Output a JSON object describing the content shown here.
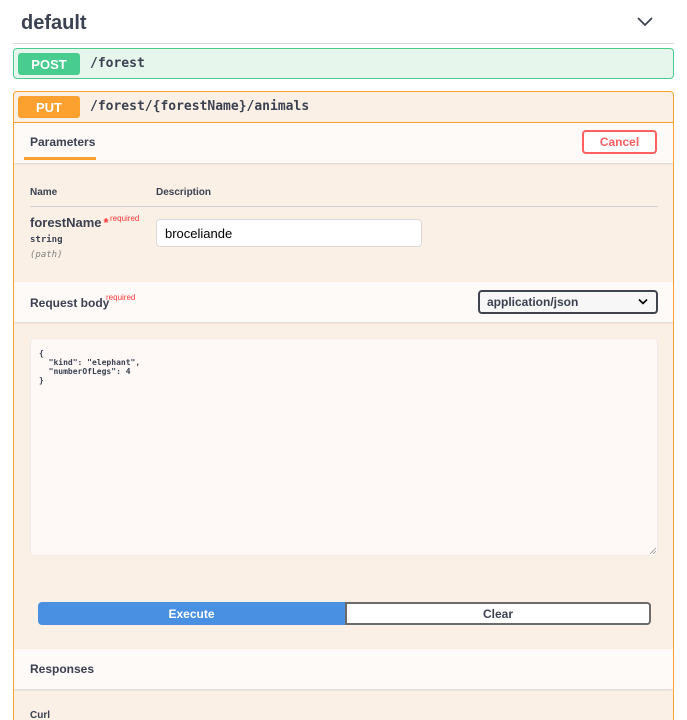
{
  "tag": {
    "title": "default",
    "chevron_icon": "chevron-down-icon"
  },
  "post_op": {
    "method": "POST",
    "path": "/forest"
  },
  "put_op": {
    "method": "PUT",
    "path": "/forest/{forestName}/animals",
    "parameters_tab": "Parameters",
    "cancel_label": "Cancel",
    "columns": {
      "name": "Name",
      "description": "Description"
    },
    "param": {
      "name": "forestName",
      "required_star": "*",
      "required_label": "required",
      "type": "string",
      "in": "(path)",
      "value": "broceliande"
    },
    "request_body": {
      "title": "Request body",
      "required_label": "required",
      "content_type": "application/json",
      "json": "{\n  \"kind\": \"elephant\",\n  \"numberOfLegs\": 4\n}"
    },
    "execute_label": "Execute",
    "clear_label": "Clear",
    "responses_title": "Responses",
    "curl_label": "Curl"
  },
  "colors": {
    "post": "#49cc90",
    "put": "#fca130",
    "execute": "#4990e2",
    "cancel": "#ff6060",
    "required": "#ff3838"
  }
}
